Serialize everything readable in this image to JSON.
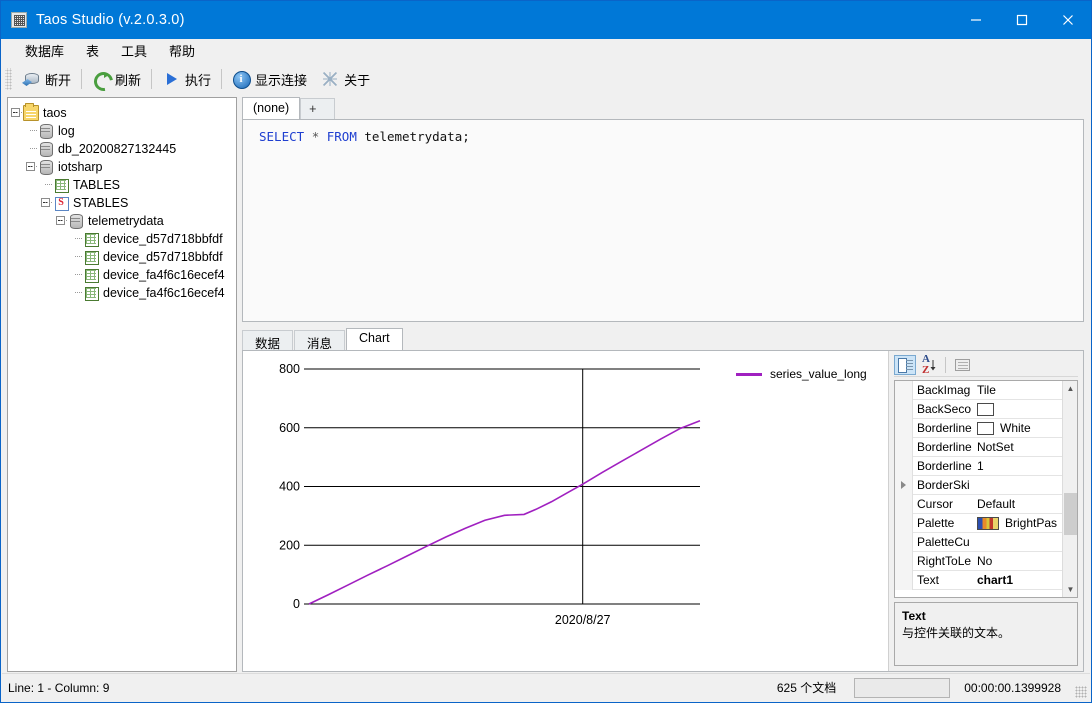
{
  "window": {
    "title": "Taos Studio (v.2.0.3.0)",
    "icon": "app-icon",
    "controls": {
      "minimize": "minimize-icon",
      "maximize": "maximize-icon",
      "close": "close-icon"
    }
  },
  "menubar": {
    "items": [
      "数据库",
      "表",
      "工具",
      "帮助"
    ]
  },
  "toolbar": {
    "buttons": [
      {
        "label": "断开",
        "icon": "disconnect-icon"
      },
      {
        "label": "刷新",
        "icon": "refresh-icon"
      },
      {
        "label": "执行",
        "icon": "play-icon"
      },
      {
        "label": "显示连接",
        "icon": "info-icon"
      },
      {
        "label": "关于",
        "icon": "about-icon"
      }
    ]
  },
  "tree": {
    "nodes": [
      {
        "label": "taos",
        "indent": 0,
        "icon": "folder-icon",
        "toggle": "expanded"
      },
      {
        "label": "log",
        "indent": 1,
        "icon": "database-icon",
        "toggle": "none"
      },
      {
        "label": "db_20200827132445",
        "indent": 1,
        "icon": "database-icon",
        "toggle": "none"
      },
      {
        "label": "iotsharp",
        "indent": 1,
        "icon": "database-icon",
        "toggle": "expanded"
      },
      {
        "label": "TABLES",
        "indent": 2,
        "icon": "table-icon",
        "toggle": "none"
      },
      {
        "label": "STABLES",
        "indent": 2,
        "icon": "stable-icon",
        "toggle": "expanded"
      },
      {
        "label": "telemetrydata",
        "indent": 3,
        "icon": "database-icon",
        "toggle": "expanded"
      },
      {
        "label": "device_d57d718bbfdf",
        "indent": 4,
        "icon": "table-icon",
        "toggle": "none"
      },
      {
        "label": "device_d57d718bbfdf",
        "indent": 4,
        "icon": "table-icon",
        "toggle": "none"
      },
      {
        "label": "device_fa4f6c16ecef4",
        "indent": 4,
        "icon": "table-icon",
        "toggle": "none"
      },
      {
        "label": "device_fa4f6c16ecef4",
        "indent": 4,
        "icon": "table-icon",
        "toggle": "none"
      }
    ]
  },
  "editor": {
    "tabs": [
      {
        "label": "(none)",
        "active": true
      },
      {
        "label": "+",
        "active": false
      }
    ],
    "sql": {
      "keyword1": "SELECT",
      "star": "*",
      "keyword2": "FROM",
      "table": "telemetrydata;"
    }
  },
  "results": {
    "tabs": [
      {
        "label": "数据",
        "active": false
      },
      {
        "label": "消息",
        "active": false
      },
      {
        "label": "Chart",
        "active": true
      }
    ]
  },
  "chart_data": {
    "type": "line",
    "title": "",
    "xlabel": "",
    "ylabel": "",
    "ylim": [
      0,
      800
    ],
    "yticks": [
      0,
      200,
      400,
      600,
      800
    ],
    "xticks": [
      "2020/8/27"
    ],
    "grid": true,
    "legend_position": "top-right",
    "series": [
      {
        "name": "series_value_long",
        "color": "#A020C0",
        "x": [
          0,
          0.05,
          0.1,
          0.15,
          0.2,
          0.25,
          0.3,
          0.35,
          0.4,
          0.45,
          0.5,
          0.55,
          0.58,
          0.62,
          0.66,
          0.7,
          0.75,
          0.8,
          0.85,
          0.9,
          0.95,
          1.0
        ],
        "values": [
          0,
          32,
          65,
          98,
          130,
          163,
          196,
          228,
          258,
          285,
          302,
          305,
          322,
          348,
          378,
          408,
          448,
          486,
          524,
          562,
          598,
          624
        ]
      }
    ]
  },
  "properties": {
    "toolbar": [
      {
        "name": "categorized-view",
        "icon": "categorized-icon",
        "selected": true
      },
      {
        "name": "alphabetical-sort",
        "icon": "sort-az-icon",
        "selected": false
      },
      {
        "name": "property-pages",
        "icon": "property-pages-icon",
        "selected": false
      }
    ],
    "rows": [
      {
        "name": "BackImag",
        "value": "Tile",
        "swatch": "",
        "expand": false,
        "bold": false
      },
      {
        "name": "BackSeco",
        "value": "",
        "swatch": "#FFFFFF",
        "expand": false,
        "bold": false
      },
      {
        "name": "Borderline",
        "value": "White",
        "swatch": "#FFFFFF",
        "expand": false,
        "bold": false
      },
      {
        "name": "Borderline",
        "value": "NotSet",
        "swatch": "",
        "expand": false,
        "bold": false
      },
      {
        "name": "Borderline",
        "value": "1",
        "swatch": "",
        "expand": false,
        "bold": false
      },
      {
        "name": "BorderSki",
        "value": "",
        "swatch": "",
        "expand": true,
        "bold": false
      },
      {
        "name": "Cursor",
        "value": "Default",
        "swatch": "",
        "expand": false,
        "bold": false
      },
      {
        "name": "Palette",
        "value": "BrightPas",
        "swatch": "palette",
        "expand": false,
        "bold": false
      },
      {
        "name": "PaletteCu",
        "value": "",
        "swatch": "",
        "expand": false,
        "bold": false
      },
      {
        "name": "RightToLe",
        "value": "No",
        "swatch": "",
        "expand": false,
        "bold": false
      },
      {
        "name": "Text",
        "value": "chart1",
        "swatch": "",
        "expand": false,
        "bold": true
      }
    ],
    "description": {
      "title": "Text",
      "body": "与控件关联的文本。"
    }
  },
  "status": {
    "position": "Line: 1 - Column: 9",
    "documents": "625 个文档",
    "elapsed": "00:00:00.1399928"
  }
}
